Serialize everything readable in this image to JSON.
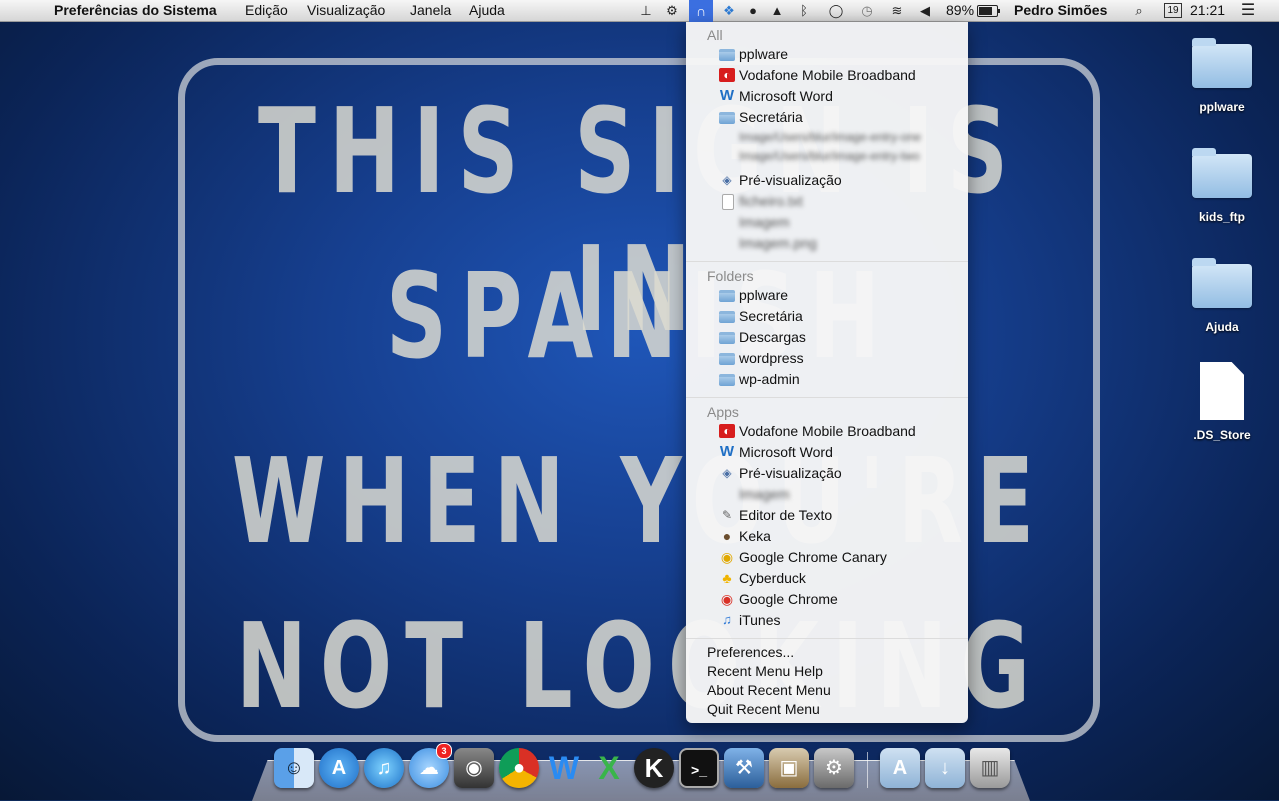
{
  "menubar": {
    "apple_glyph": "",
    "app_name": "Preferências do Sistema",
    "menus": [
      "Edição",
      "Visualização",
      "Janela",
      "Ajuda"
    ],
    "recent_menu_glyph": "∩",
    "battery_percent": "89%",
    "battery_level": 0.89,
    "user_name": "Pedro Simões",
    "date_day": "19",
    "time": "21:21"
  },
  "wallpaper": {
    "lines": [
      "THIS SIGN IS IN",
      "SPANISH",
      "WHEN YOU'RE",
      "NOT LOOKING"
    ]
  },
  "dropdown": {
    "all_header": "All",
    "all_items": [
      {
        "label": "pplware",
        "icon": "folder-icon"
      },
      {
        "label": "Vodafone Mobile Broadband",
        "icon": "vodafone-icon"
      },
      {
        "label": "Microsoft Word",
        "icon": "word-icon"
      },
      {
        "label": "Secretária",
        "icon": "folder-icon"
      },
      {
        "label": "Image/Users/blur/image-entry-one",
        "icon": "",
        "blurred": true
      },
      {
        "label": "Image/Users/blur/image-entry-two",
        "icon": "",
        "blurred": true
      },
      {
        "label": "Pré-visualização",
        "icon": "preview-icon"
      },
      {
        "label": "ficheiro.txt",
        "icon": "document-icon",
        "blurred": true
      },
      {
        "label": "Imagem",
        "icon": "",
        "blurred": true
      },
      {
        "label": "Imagem.png",
        "icon": "",
        "blurred": true
      }
    ],
    "folders_header": "Folders",
    "folder_items": [
      "pplware",
      "Secretária",
      "Descargas",
      "wordpress",
      "wp-admin"
    ],
    "apps_header": "Apps",
    "app_items": [
      {
        "label": "Vodafone Mobile Broadband",
        "icon": "vodafone-icon"
      },
      {
        "label": "Microsoft Word",
        "icon": "word-icon"
      },
      {
        "label": "Pré-visualização",
        "icon": "preview-icon"
      },
      {
        "label": "Imagem",
        "icon": "",
        "blurred": true
      },
      {
        "label": "Editor de Texto",
        "icon": "text-editor-icon"
      },
      {
        "label": "Keka",
        "icon": "keka-icon"
      },
      {
        "label": "Google Chrome Canary",
        "icon": "chrome-canary-icon"
      },
      {
        "label": "Cyberduck",
        "icon": "cyberduck-icon"
      },
      {
        "label": "Google Chrome",
        "icon": "chrome-icon"
      },
      {
        "label": "iTunes",
        "icon": "itunes-icon"
      }
    ],
    "actions": [
      "Preferences...",
      "Recent Menu Help",
      "About Recent Menu",
      "Quit Recent Menu"
    ]
  },
  "desktop_icons": [
    {
      "label": "pplware",
      "kind": "folder"
    },
    {
      "label": "kids_ftp",
      "kind": "folder"
    },
    {
      "label": "Ajuda",
      "kind": "folder"
    },
    {
      "label": ".DS_Store",
      "kind": "document"
    }
  ],
  "dock": {
    "messages_badge": "3",
    "apps": [
      "finder-icon",
      "app-store-icon",
      "itunes-icon",
      "messages-icon",
      "facetime-icon",
      "chrome-icon",
      "word-icon",
      "excel-icon",
      "klite-icon",
      "terminal-icon",
      "xcode-icon",
      "preview-icon",
      "system-preferences-icon"
    ],
    "stacks": [
      "applications-stack-icon",
      "downloads-stack-icon",
      "trash-icon"
    ]
  },
  "colors": {
    "highlight": "#3b6fe0",
    "wallpaper_blue": "#1f56b8"
  }
}
